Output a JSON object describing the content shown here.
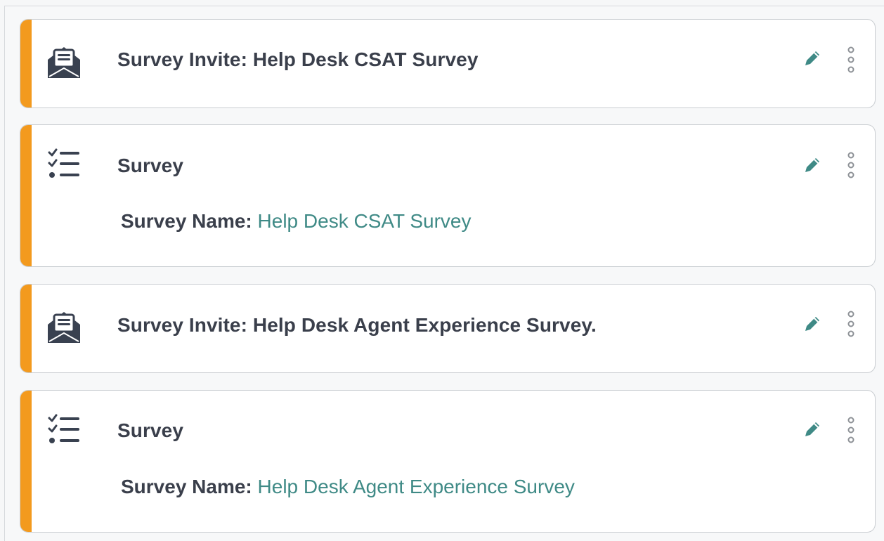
{
  "colors": {
    "accent": "#f39a1e",
    "title_text": "#3a3f4b",
    "link_text": "#3f8a86",
    "icon_dark": "#394150",
    "edit_icon": "#3f8a86",
    "more_icon": "#8d9196"
  },
  "steps": [
    {
      "type": "survey-invite",
      "icon": "envelope-open-icon",
      "title": "Survey Invite: Help Desk CSAT Survey"
    },
    {
      "type": "survey",
      "icon": "checklist-icon",
      "title": "Survey",
      "detail_label": "Survey Name:",
      "detail_value": "Help Desk CSAT Survey"
    },
    {
      "type": "survey-invite",
      "icon": "envelope-open-icon",
      "title": "Survey Invite: Help Desk Agent Experience Survey."
    },
    {
      "type": "survey",
      "icon": "checklist-icon",
      "title": "Survey",
      "detail_label": "Survey Name:",
      "detail_value": "Help Desk Agent Experience Survey"
    }
  ],
  "actions": {
    "edit_icon": "pencil-icon",
    "more_icon": "kebab-menu-icon"
  }
}
